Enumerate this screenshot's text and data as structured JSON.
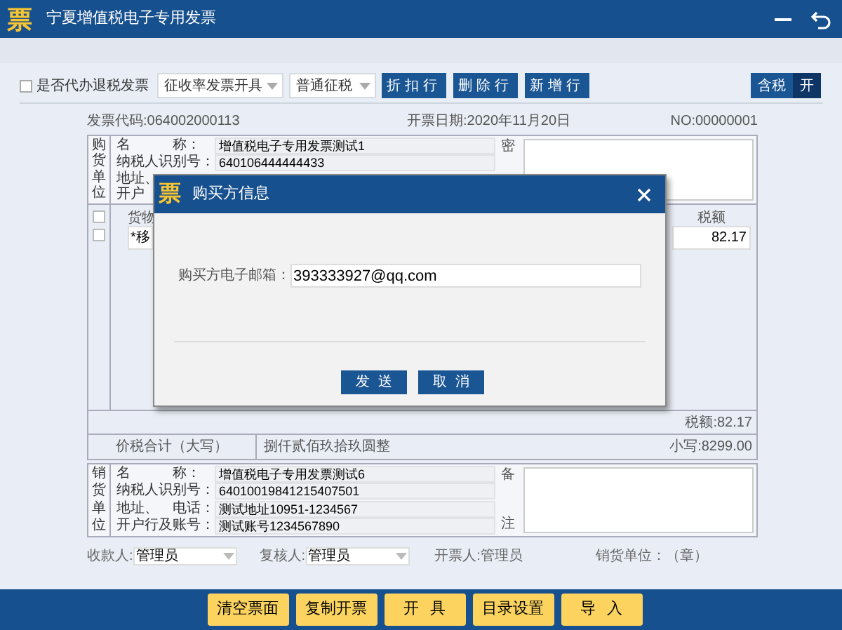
{
  "window": {
    "logo": "票",
    "title": "宁夏增值税电子专用发票"
  },
  "toolbar": {
    "checkbox": {
      "label": "是否代办退税发票",
      "checked": false
    },
    "selects": [
      "征收率发票开具",
      "普通征税"
    ],
    "buttons": [
      "折扣行",
      "删除行",
      "新增行"
    ],
    "tax_toggle": {
      "label": "含税",
      "state": "开",
      "on": true
    }
  },
  "invoice": {
    "code": "发票代码:064002000113",
    "date": "开票日期:2020年11月20日",
    "number": "NO:00000001"
  },
  "buyer": {
    "side_label": [
      "购",
      "货",
      "单",
      "位"
    ],
    "fields": [
      {
        "label": "名　　　称：",
        "value": "增值税电子专用发票测试1"
      },
      {
        "label": "纳税人识别号：",
        "value": "640106444444433"
      },
      {
        "label": "地址、"
      },
      {
        "label": "开户"
      }
    ],
    "remarks_label": [
      "密"
    ]
  },
  "goods": {
    "columns": [
      "货物",
      "税额"
    ],
    "header_checked": false,
    "rows": [
      {
        "checked": false,
        "name": "*移",
        "tax": "82.17"
      }
    ]
  },
  "tax_total": "税额:82.17",
  "total": {
    "label": "价税合计（大写）",
    "words": "捌仟贰佰玖拾玖圆整",
    "figure": "小写:8299.00"
  },
  "seller": {
    "side_label": [
      "销",
      "货",
      "单",
      "位"
    ],
    "fields": [
      {
        "label": "名　　　称：",
        "value": "增值税电子专用发票测试6"
      },
      {
        "label": "纳税人识别号：",
        "value": "64010019841215407501"
      },
      {
        "label": "地址、　电话：",
        "value": "测试地址10951-1234567"
      },
      {
        "label": "开户行及账号：",
        "value": "测试账号1234567890"
      }
    ],
    "remarks_label": [
      "备",
      "注"
    ]
  },
  "signatures": [
    {
      "kind": "select",
      "label": "收款人:",
      "value": "管理员"
    },
    {
      "kind": "select",
      "label": "复核人:",
      "value": "管理员"
    },
    {
      "kind": "text",
      "label": "开票人:管理员"
    },
    {
      "kind": "text",
      "label": "销货单位：（章）"
    }
  ],
  "actions": [
    "清空票面",
    "复制开票",
    "开具",
    "目录设置",
    "导入"
  ],
  "dialog": {
    "logo": "票",
    "title": "购买方信息",
    "field": {
      "label": "购买方电子邮箱：",
      "value": "393333927@qq.com"
    },
    "buttons": [
      "发送",
      "取消"
    ]
  }
}
